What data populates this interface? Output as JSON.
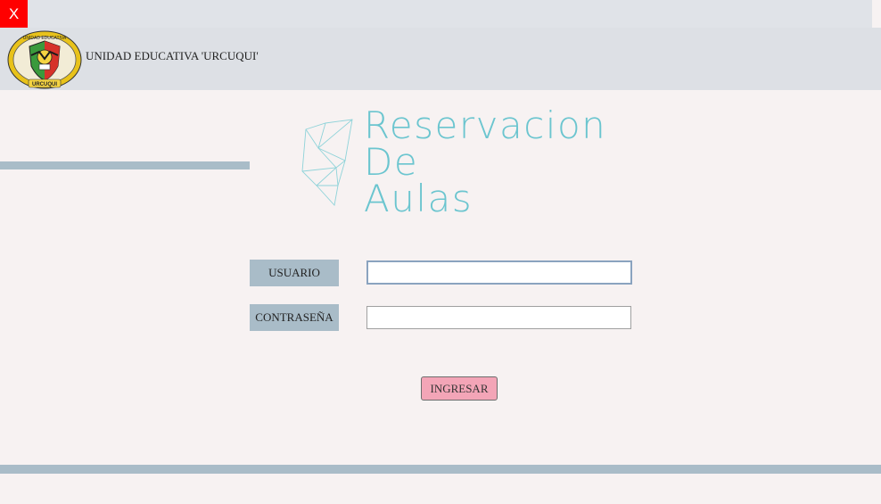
{
  "window": {
    "close_label": "X"
  },
  "header": {
    "school_name": "UNIDAD EDUCATIVA 'URCUQUI'",
    "logo_text_top": "UNIDAD EDUCATIVA",
    "logo_text_bottom": "URCUQUI"
  },
  "hero": {
    "title_lines": [
      "Reservacion",
      "De",
      "Aulas"
    ]
  },
  "form": {
    "user_label": "USUARIO",
    "user_value": "",
    "password_label": "CONTRASEÑA",
    "password_value": "",
    "submit_label": "INGRESAR"
  },
  "colors": {
    "accent_bar": "#a9bcc8",
    "title": "#6bc5cf",
    "submit": "#f3a5b7",
    "close": "#ff0000"
  }
}
